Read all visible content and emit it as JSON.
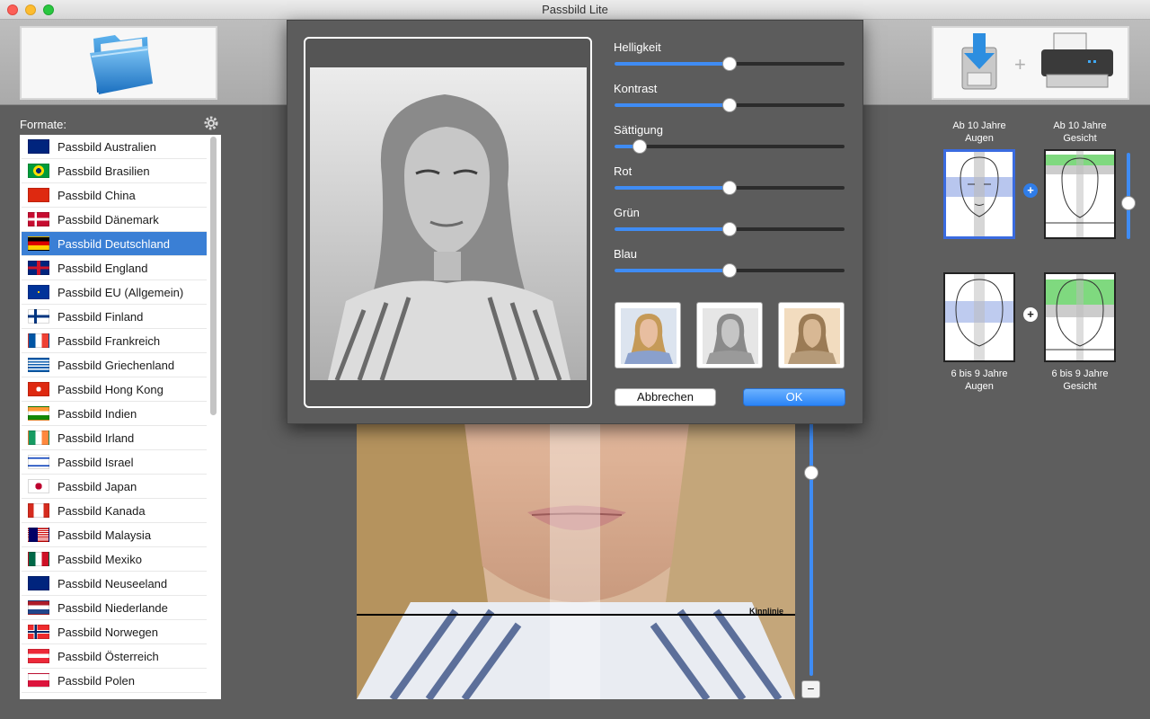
{
  "window": {
    "title": "Passbild Lite"
  },
  "sidebar": {
    "label": "Formate:",
    "items": [
      {
        "label": "Passbild Australien",
        "flag": "au"
      },
      {
        "label": "Passbild Brasilien",
        "flag": "br"
      },
      {
        "label": "Passbild China",
        "flag": "cn"
      },
      {
        "label": "Passbild Dänemark",
        "flag": "dk"
      },
      {
        "label": "Passbild Deutschland",
        "flag": "de",
        "selected": true
      },
      {
        "label": "Passbild England",
        "flag": "gb"
      },
      {
        "label": "Passbild EU (Allgemein)",
        "flag": "eu"
      },
      {
        "label": "Passbild Finland",
        "flag": "fi"
      },
      {
        "label": "Passbild Frankreich",
        "flag": "fr"
      },
      {
        "label": "Passbild Griechenland",
        "flag": "gr"
      },
      {
        "label": "Passbild Hong Kong",
        "flag": "hk"
      },
      {
        "label": "Passbild Indien",
        "flag": "in"
      },
      {
        "label": "Passbild Irland",
        "flag": "ie"
      },
      {
        "label": "Passbild Israel",
        "flag": "il"
      },
      {
        "label": "Passbild Japan",
        "flag": "jp"
      },
      {
        "label": "Passbild Kanada",
        "flag": "ca"
      },
      {
        "label": "Passbild Malaysia",
        "flag": "my"
      },
      {
        "label": "Passbild Mexiko",
        "flag": "mx"
      },
      {
        "label": "Passbild Neuseeland",
        "flag": "nz"
      },
      {
        "label": "Passbild Niederlande",
        "flag": "nl"
      },
      {
        "label": "Passbild Norwegen",
        "flag": "no"
      },
      {
        "label": "Passbild Österreich",
        "flag": "at"
      },
      {
        "label": "Passbild Polen",
        "flag": "pl"
      }
    ]
  },
  "dialog": {
    "sliders": [
      {
        "label": "Helligkeit",
        "value": 0.5
      },
      {
        "label": "Kontrast",
        "value": 0.5
      },
      {
        "label": "Sättigung",
        "value": 0.11
      },
      {
        "label": "Rot",
        "value": 0.5
      },
      {
        "label": "Grün",
        "value": 0.5
      },
      {
        "label": "Blau",
        "value": 0.5
      }
    ],
    "presets": [
      "color-preset",
      "grayscale-preset",
      "sepia-preset"
    ],
    "cancel_label": "Abbrechen",
    "ok_label": "OK"
  },
  "guides": {
    "adult_eyes": [
      "Ab 10 Jahre",
      "Augen"
    ],
    "adult_face": [
      "Ab 10 Jahre",
      "Gesicht"
    ],
    "child_eyes": [
      "6 bis 9 Jahre",
      "Augen"
    ],
    "child_face": [
      "6 bis 9 Jahre",
      "Gesicht"
    ],
    "plus": "+"
  },
  "main": {
    "chin_label": "Kinnlinie",
    "minus_label": "−"
  },
  "colors": {
    "accent": "#3f8cf4",
    "selection": "#3a7fd5"
  }
}
